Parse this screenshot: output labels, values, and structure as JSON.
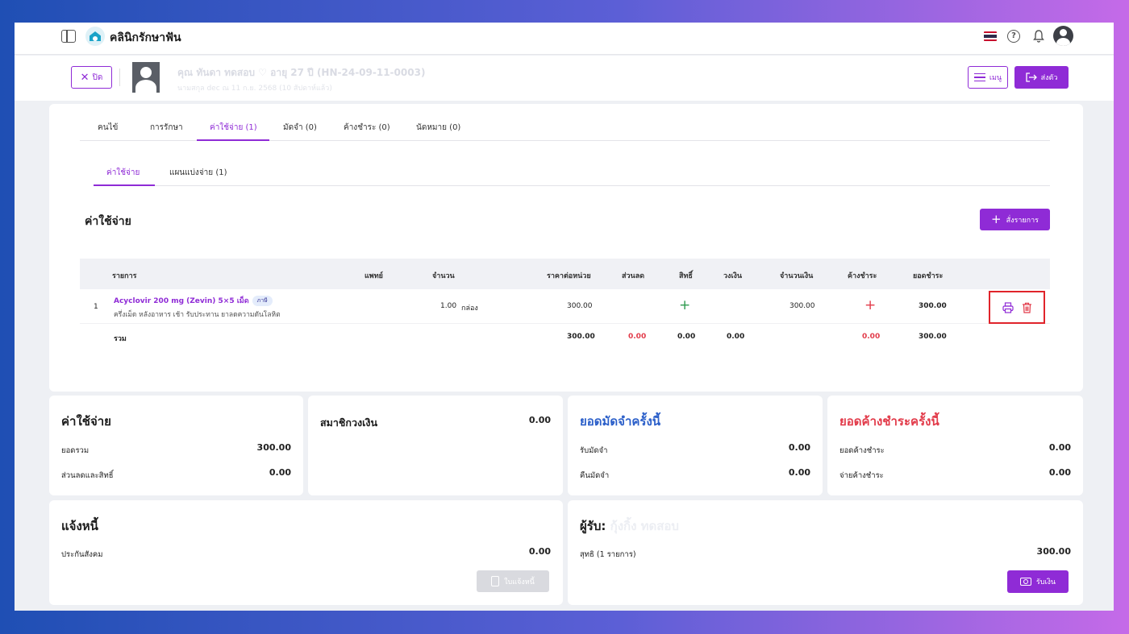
{
  "app": {
    "title": "คลินิกรักษาฟัน"
  },
  "patient": {
    "close_label": "ปิด",
    "name": "คุณ ทันดา ทดสอบ  ♡  อายุ 27 ปี  (HN-24-09-11-0003)",
    "sub": "นามสกุล dec ณ 11 ก.ย. 2568 (10 สัปดาห์แล้ว)",
    "menu_label": "เมนู",
    "send_label": "ส่งตัว"
  },
  "tabs": [
    {
      "label": "คนไข้"
    },
    {
      "label": "การรักษา"
    },
    {
      "label": "ค่าใช้จ่าย (1)"
    },
    {
      "label": "มัดจำ (0)"
    },
    {
      "label": "ค้างชำระ (0)"
    },
    {
      "label": "นัดหมาย (0)"
    }
  ],
  "subtabs": [
    {
      "label": "ค่าใช้จ่าย"
    },
    {
      "label": "แผนแบ่งจ่าย (1)"
    }
  ],
  "section": {
    "title": "ค่าใช้จ่าย",
    "add_label": "สั่งรายการ"
  },
  "table": {
    "headers": {
      "item": "รายการ",
      "doctor": "แพทย์",
      "qty": "จำนวน",
      "unit_price": "ราคาต่อหน่วย",
      "discount": "ส่วนลด",
      "rights": "สิทธิ์",
      "credit": "วงเงิน",
      "amount": "จำนวนเงิน",
      "outstanding": "ค้างชำระ",
      "pay_total": "ยอดชำระ"
    },
    "rows": [
      {
        "no": "1",
        "name": "Acyclovir 200 mg (Zevin) 5×5 เม็ด",
        "badge": "ภาษี",
        "desc": "ครึ่งเม็ด หลังอาหาร เช้า รับประทาน ยาลดความดันโลหิต",
        "qty": "1.00",
        "unit": "กล่อง",
        "unit_price": "300.00",
        "amount": "300.00",
        "pay_total": "300.00"
      }
    ],
    "summary": {
      "label": "รวม",
      "unit_price": "300.00",
      "discount": "0.00",
      "rights": "0.00",
      "credit": "0.00",
      "outstanding": "0.00",
      "pay_total": "300.00"
    }
  },
  "summary_cards": {
    "expense": {
      "title": "ค่าใช้จ่าย",
      "total_label": "ยอดรวม",
      "total": "300.00",
      "discount_label": "ส่วนลดและสิทธิ์",
      "discount": "0.00"
    },
    "member": {
      "title": "สมาชิกวงเงิน",
      "value": "0.00"
    },
    "deposit": {
      "title": "ยอดมัดจำครั้งนี้",
      "receive_label": "รับมัดจำ",
      "receive": "0.00",
      "refund_label": "คืนมัดจำ",
      "refund": "0.00"
    },
    "outstanding": {
      "title": "ยอดค้างชำระครั้งนี้",
      "owed_label": "ยอดค้างชำระ",
      "owed": "0.00",
      "paid_label": "จ่ายค้างชำระ",
      "paid": "0.00"
    },
    "invoice": {
      "title": "แจ้งหนี้",
      "insurer_label": "ประกันสังคม",
      "insurer": "0.00",
      "button_label": "ใบแจ้งหนี้"
    },
    "receiver": {
      "title": "ผู้รับ:",
      "name": "กุ้งกิ้ง ทดสอบ",
      "net_label": "สุทธิ (1 รายการ)",
      "net": "300.00",
      "button_label": "รับเงิน"
    }
  },
  "colors": {
    "accent": "#8f2bd6",
    "red": "#e23b4a",
    "blue": "#2b5fc9",
    "green": "#2e9b4f"
  },
  "icons": [
    "sidebar-toggle-icon",
    "clinic-logo-icon",
    "thai-flag-icon",
    "help-icon",
    "bell-icon",
    "avatar",
    "print-icon",
    "trash-icon",
    "plus-icon"
  ]
}
